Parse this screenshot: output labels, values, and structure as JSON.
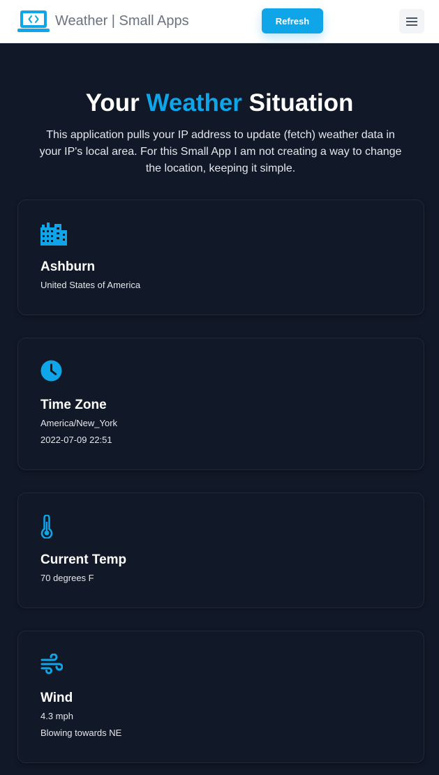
{
  "navbar": {
    "brand_text": "Weather | Small Apps",
    "refresh_label": "Refresh",
    "logo_icon": "laptop-code-icon",
    "menu_icon": "hamburger-menu-icon",
    "accent_color": "#0ea5e9"
  },
  "hero": {
    "title_before": "Your ",
    "title_accent": "Weather",
    "title_after": " Situation",
    "description": "This application pulls your IP address to update (fetch) weather data in your IP's local area. For this Small App I am not creating a way to change the location, keeping it simple."
  },
  "cards": {
    "location": {
      "icon": "city-buildings-icon",
      "title": "Ashburn",
      "line1": "United States of America"
    },
    "timezone": {
      "icon": "clock-icon",
      "title": "Time Zone",
      "line1": "America/New_York",
      "line2": "2022-07-09 22:51"
    },
    "temperature": {
      "icon": "thermometer-icon",
      "title": "Current Temp",
      "line1": "70 degrees F"
    },
    "wind": {
      "icon": "wind-icon",
      "title": "Wind",
      "line1": "4.3 mph",
      "line2": "Blowing towards NE"
    }
  },
  "colors": {
    "page_background": "#111827",
    "accent": "#0ea5e9"
  }
}
